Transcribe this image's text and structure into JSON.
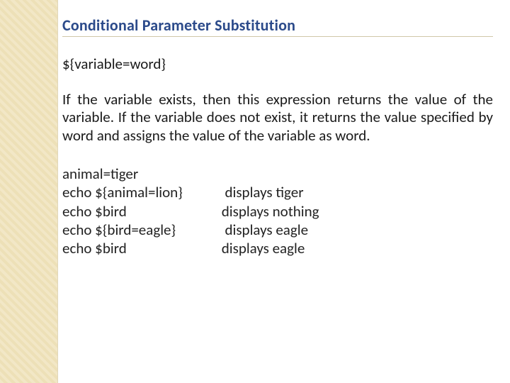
{
  "slide": {
    "heading": "Conditional Parameter Substitution",
    "syntax": "${variable=word}",
    "description": "If the variable exists, then this expression returns the value of the variable.\nIf the variable does not exist, it returns the value specified by word and assigns the value of the variable as word.",
    "example": {
      "setup": "animal=tiger",
      "rows": [
        {
          "cmd": "echo ${animal=lion}",
          "out": "  displays tiger"
        },
        {
          "cmd": "echo $bird",
          "out": " displays nothing"
        },
        {
          "cmd": "echo ${bird=eagle}",
          "out": "  displays eagle"
        },
        {
          "cmd": "echo $bird",
          "out": " displays eagle"
        }
      ]
    }
  }
}
